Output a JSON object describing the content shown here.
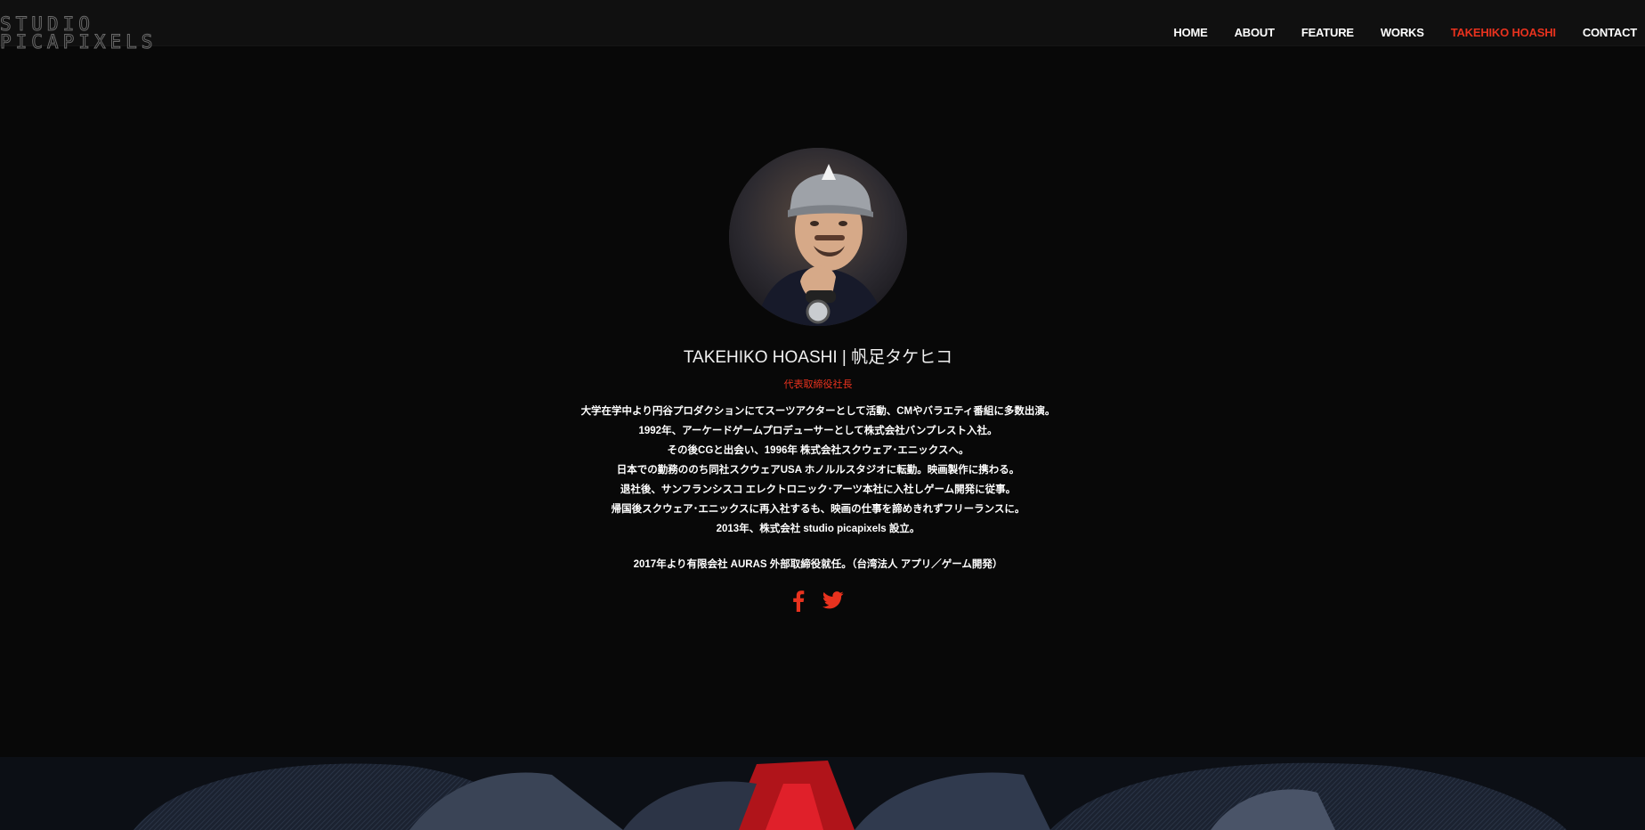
{
  "logo": {
    "line1": "STUDIO",
    "line2": "PICAPIXELS"
  },
  "nav": {
    "home": "HOME",
    "about": "ABOUT",
    "feature": "FEATURE",
    "works": "WORKS",
    "takehiko": "TAKEHIKO HOASHI",
    "contact": "CONTACT"
  },
  "profile": {
    "name": "TAKEHIKO HOASHI | 帆足タケヒコ",
    "role": "代表取締役社長",
    "bio": [
      "大学在学中より円谷プロダクションにてスーツアクターとして活動、CMやバラエティ番組に多数出演。",
      "1992年、アーケードゲームプロデューサーとして株式会社バンプレスト入社。",
      "その後CGと出会い、1996年 株式会社スクウェア･エニックスへ。",
      "日本での勤務ののち同社スクウェアUSA ホノルルスタジオに転勤。映画製作に携わる。",
      "退社後、サンフランシスコ エレクトロニック･アーツ本社に入社しゲーム開発に従事。",
      "帰国後スクウェア･エニックスに再入社するも、映画の仕事を諦めきれずフリーランスに。",
      "2013年、株式会社 studio picapixels 設立。"
    ],
    "bio_extra": "2017年より有限会社 AURAS 外部取締役就任。（台湾法人 アプリ／ゲーム開発）"
  },
  "icons": {
    "facebook": "facebook-icon",
    "twitter": "twitter-icon"
  },
  "colors": {
    "accent": "#e8321e",
    "background": "#080808",
    "header": "#101010"
  }
}
